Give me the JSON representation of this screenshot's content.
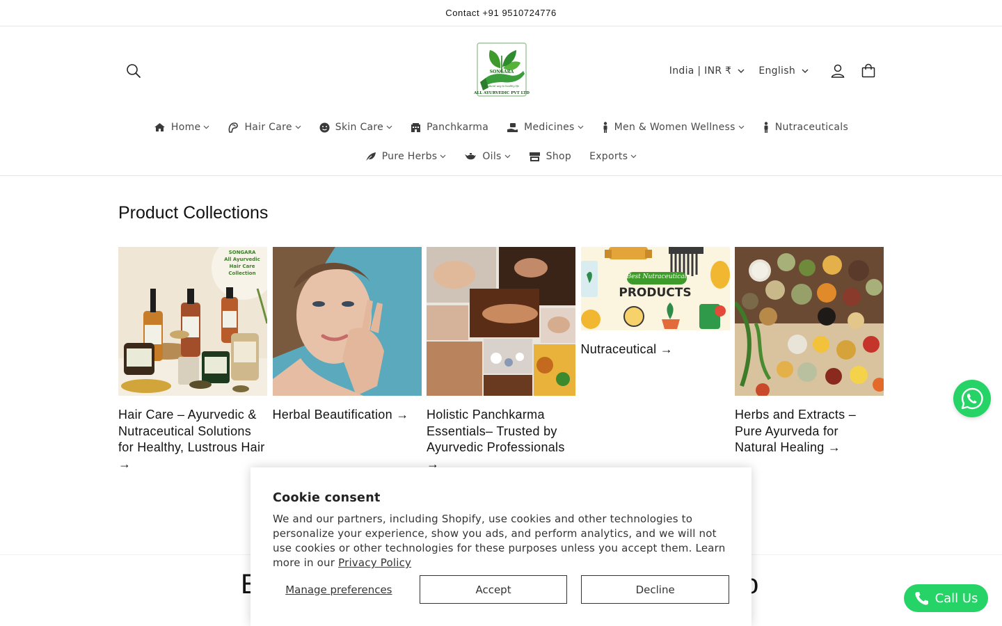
{
  "announcement": {
    "text": "Contact +91 9510724776"
  },
  "header": {
    "logo": {
      "brand": "SONGARA",
      "tagline": "A natural way to healthy life",
      "company": "ALL AYURVEDIC PVT LTD"
    },
    "country_selector": "India | INR ₹",
    "language_selector": "English",
    "icons": {
      "search": "search-icon",
      "account": "account-icon",
      "cart": "cart-icon"
    }
  },
  "nav": {
    "row1": [
      {
        "label": "Home",
        "icon": "home-icon",
        "dropdown": true
      },
      {
        "label": "Hair Care",
        "icon": "hair-care-icon",
        "dropdown": true
      },
      {
        "label": "Skin Care",
        "icon": "smiley-face-icon",
        "dropdown": true
      },
      {
        "label": "Panchkarma",
        "icon": "clinic-icon",
        "dropdown": false
      },
      {
        "label": "Medicines",
        "icon": "medicine-hand-icon",
        "dropdown": true
      },
      {
        "label": "Men & Women Wellness",
        "icon": "person-icon",
        "dropdown": true
      },
      {
        "label": "Nutraceuticals",
        "icon": "person-icon",
        "dropdown": false
      }
    ],
    "row2": [
      {
        "label": "Pure Herbs",
        "icon": "leaf-icon",
        "dropdown": true
      },
      {
        "label": "Oils",
        "icon": "oil-lamp-icon",
        "dropdown": true
      },
      {
        "label": "Shop",
        "icon": "store-icon",
        "dropdown": false
      },
      {
        "label": "Exports",
        "icon": "",
        "dropdown": true
      }
    ]
  },
  "collections": {
    "title": "Product Collections",
    "items": [
      {
        "title": "Hair Care – Ayurvedic & Nutraceutical Solutions for Healthy, Lustrous Hair →",
        "badge": {
          "brand": "SONGARA",
          "line1": "All Ayurvedic",
          "line2": "Hair Care Collection"
        }
      },
      {
        "title": "Herbal Beautification →"
      },
      {
        "title": "Holistic Panchkarma Essentials– Trusted by Ayurvedic Professionals →"
      },
      {
        "title": "Nutraceutical →",
        "image_text": {
          "script": "Best Nutraceutical",
          "main": "PRODUCTS"
        }
      },
      {
        "title": "Herbs and Extracts – Pure Ayurveda for Natural Healing →"
      }
    ]
  },
  "bottom_band": {
    "left_fragment": "E",
    "right_fragment": "o"
  },
  "floating": {
    "whatsapp_icon": "whatsapp-icon",
    "call_us_label": "Call Us"
  },
  "cookie_consent": {
    "title": "Cookie consent",
    "body": "We and our partners, including Shopify, use cookies and other technologies to personalize your experience, show you ads, and perform analytics, and we will not use cookies or other technologies for these purposes unless you accept them. Learn more in our ",
    "privacy_link": "Privacy Policy",
    "manage_label": "Manage preferences",
    "accept_label": "Accept",
    "decline_label": "Decline"
  },
  "colors": {
    "whatsapp_green": "#25d366",
    "logo_green": "#2e8b2e",
    "text": "#121212"
  }
}
